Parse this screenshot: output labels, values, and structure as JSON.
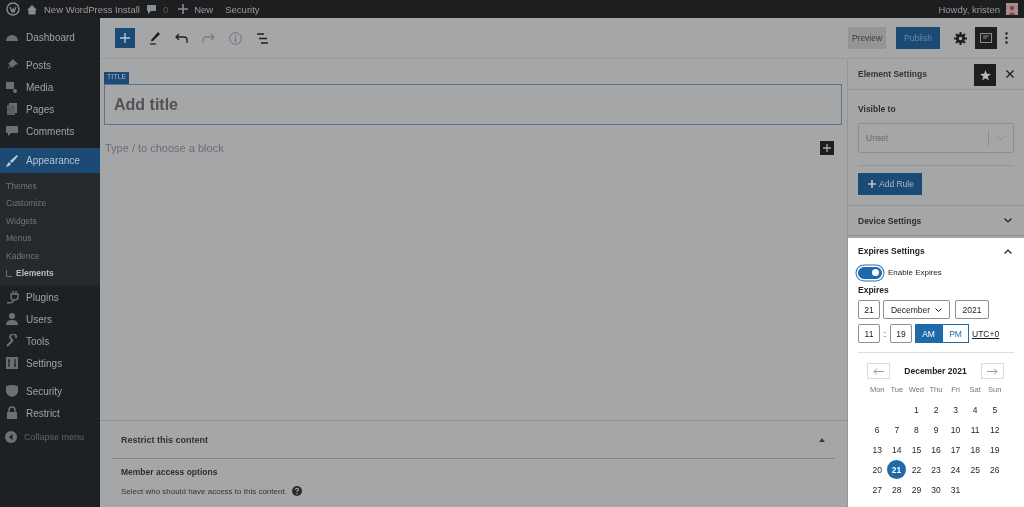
{
  "admin_bar": {
    "site": "New WordPress Install",
    "comments": "0",
    "new": "New",
    "security": "Security",
    "greeting": "Howdy, kristen"
  },
  "sidebar": {
    "groups": [
      {
        "items": [
          {
            "label": "Dashboard",
            "selected": false
          }
        ]
      },
      {
        "items": [
          {
            "label": "Posts",
            "selected": false
          },
          {
            "label": "Media",
            "selected": false
          },
          {
            "label": "Pages",
            "selected": false
          },
          {
            "label": "Comments",
            "selected": false
          }
        ]
      },
      {
        "items": [
          {
            "label": "Appearance",
            "selected": true,
            "children": [
              {
                "label": "Themes",
                "selected": false
              },
              {
                "label": "Customize",
                "selected": false
              },
              {
                "label": "Widgets",
                "selected": false
              },
              {
                "label": "Menus",
                "selected": false
              },
              {
                "label": "Kadence",
                "selected": false
              },
              {
                "label": "Elements",
                "selected": true
              }
            ]
          },
          {
            "label": "Plugins",
            "selected": false
          },
          {
            "label": "Users",
            "selected": false
          },
          {
            "label": "Tools",
            "selected": false
          },
          {
            "label": "Settings",
            "selected": false
          }
        ]
      },
      {
        "items": [
          {
            "label": "Security",
            "selected": false
          },
          {
            "label": "Restrict",
            "selected": false
          }
        ]
      }
    ],
    "collapse": "Collapse menu"
  },
  "toolbar": {
    "preview": "Preview",
    "publish": "Publish"
  },
  "editor": {
    "title_tag": "TITLE",
    "title_placeholder": "Add title",
    "block_placeholder": "Type / to choose a block"
  },
  "metabox": {
    "title": "Restrict this content",
    "heading": "Member access options",
    "text": "Select who should have access to this content."
  },
  "settings_panel": {
    "title": "Element Settings",
    "visible_to": "Visible to",
    "select_value": "Unset",
    "add_rule": "Add Rule",
    "device_settings": "Device Settings",
    "expires": {
      "title": "Expires Settings",
      "toggle_label": "Enable Expires",
      "on": true,
      "label": "Expires",
      "day": "21",
      "month": "December",
      "year": "2021",
      "hour": "11",
      "time_separator": ":",
      "minute": "19",
      "am": "AM",
      "pm": "PM",
      "am_selected": true,
      "timezone": "UTC+0",
      "calendar": {
        "title": "December 2021",
        "weekdays": [
          "Mon",
          "Tue",
          "Wed",
          "Thu",
          "Fri",
          "Sat",
          "Sun"
        ],
        "weeks": [
          [
            {
              "label": "1",
              "selected": false
            },
            {
              "label": "2",
              "selected": false
            },
            {
              "label": "3",
              "selected": false
            },
            {
              "label": "4",
              "selected": false
            },
            {
              "label": "5",
              "selected": false
            }
          ],
          [
            {
              "label": "6",
              "selected": false
            },
            {
              "label": "7",
              "selected": false
            },
            {
              "label": "8",
              "selected": false
            },
            {
              "label": "9",
              "selected": false
            },
            {
              "label": "10",
              "selected": false
            },
            {
              "label": "11",
              "selected": false
            },
            {
              "label": "12",
              "selected": false
            }
          ],
          [
            {
              "label": "13",
              "selected": false
            },
            {
              "label": "14",
              "selected": false
            },
            {
              "label": "15",
              "selected": false
            },
            {
              "label": "16",
              "selected": false
            },
            {
              "label": "17",
              "selected": false
            },
            {
              "label": "18",
              "selected": false
            },
            {
              "label": "19",
              "selected": false
            }
          ],
          [
            {
              "label": "20",
              "selected": false
            },
            {
              "label": "21",
              "selected": true
            },
            {
              "label": "22",
              "selected": false
            },
            {
              "label": "23",
              "selected": false
            },
            {
              "label": "24",
              "selected": false
            },
            {
              "label": "25",
              "selected": false
            },
            {
              "label": "26",
              "selected": false
            }
          ],
          [
            {
              "label": "27",
              "selected": false
            },
            {
              "label": "28",
              "selected": false
            },
            {
              "label": "29",
              "selected": false
            },
            {
              "label": "30",
              "selected": false
            },
            {
              "label": "31",
              "selected": false
            }
          ]
        ]
      }
    }
  }
}
